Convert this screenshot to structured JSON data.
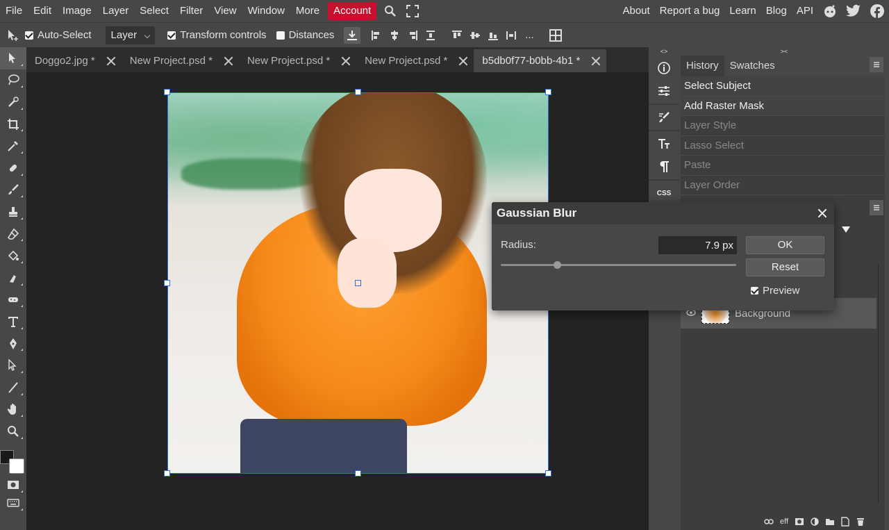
{
  "menubar": {
    "items": [
      "File",
      "Edit",
      "Image",
      "Layer",
      "Select",
      "Filter",
      "View",
      "Window",
      "More"
    ],
    "account": "Account",
    "right": [
      "About",
      "Report a bug",
      "Learn",
      "Blog",
      "API"
    ]
  },
  "options": {
    "auto_select": "Auto-Select",
    "auto_select_target": "Layer",
    "transform_controls": "Transform controls",
    "distances": "Distances",
    "more": "..."
  },
  "tabs": [
    {
      "label": "Doggo2.jpg *"
    },
    {
      "label": "New Project.psd *"
    },
    {
      "label": "New Project.psd *"
    },
    {
      "label": "New Project.psd *"
    },
    {
      "label": "b5db0f77-b0bb-4b1 *"
    }
  ],
  "iconstrip": {
    "top_label": "<>",
    "css_label": "CSS"
  },
  "history_panel": {
    "collapse_label": "><",
    "tabs": [
      "History",
      "Swatches"
    ],
    "items": [
      {
        "label": "Select Subject",
        "done": true
      },
      {
        "label": "Add Raster Mask",
        "done": true
      },
      {
        "label": "Layer Style",
        "done": false
      },
      {
        "label": "Lasso Select",
        "done": false
      },
      {
        "label": "Paste",
        "done": false
      },
      {
        "label": "Layer Order",
        "done": false
      }
    ]
  },
  "layers_panel": {
    "layer_name": "Background",
    "footer_eff": "eff"
  },
  "dialog": {
    "title": "Gaussian Blur",
    "radius_label": "Radius:",
    "radius_value": "7.9 px",
    "slider_fraction": 0.24,
    "ok": "OK",
    "reset": "Reset",
    "preview": "Preview"
  },
  "colors": {
    "accent": "#c8102e",
    "selection": "#2f6dd8"
  }
}
